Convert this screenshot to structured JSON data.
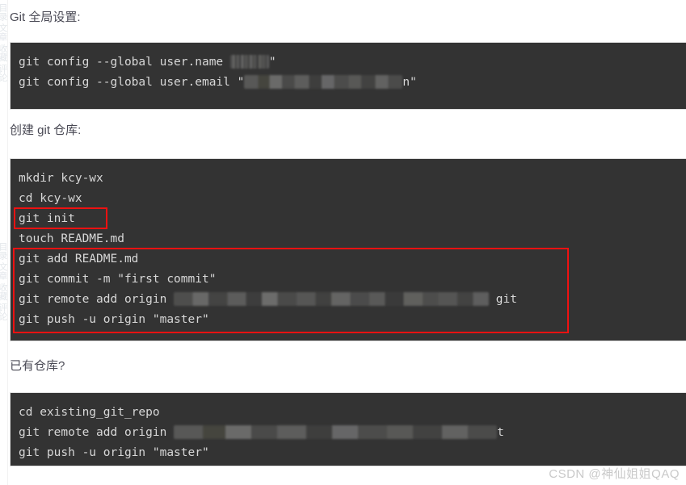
{
  "page": {
    "background": "#ffffff",
    "code_background": "#333333",
    "code_text_color": "#d7d7d7",
    "title_color": "#4a4a55",
    "annotation_color": "#ee1111"
  },
  "sections": [
    {
      "id": "global-settings",
      "title": "Git 全局设置:",
      "lines": [
        {
          "prefix": "git config --global user.name ",
          "redacted": true,
          "suffix": "\""
        },
        {
          "prefix": "git config --global user.email \"",
          "redacted": true,
          "suffix": "n\""
        }
      ]
    },
    {
      "id": "create-repo",
      "title": "创建 git 仓库:",
      "lines": [
        {
          "prefix": "mkdir kcy-wx",
          "redacted": false,
          "suffix": ""
        },
        {
          "prefix": "cd kcy-wx",
          "redacted": false,
          "suffix": ""
        },
        {
          "prefix": "git init",
          "redacted": false,
          "suffix": ""
        },
        {
          "prefix": "touch README.md",
          "redacted": false,
          "suffix": ""
        },
        {
          "prefix": "git add README.md",
          "redacted": false,
          "suffix": ""
        },
        {
          "prefix": "git commit -m \"first commit\"",
          "redacted": false,
          "suffix": ""
        },
        {
          "prefix": "git remote add origin ",
          "redacted": true,
          "suffix": " git"
        },
        {
          "prefix": "git push -u origin \"master\"",
          "redacted": false,
          "suffix": ""
        }
      ]
    },
    {
      "id": "existing-repo",
      "title": "已有仓库?",
      "lines": [
        {
          "prefix": "cd existing_git_repo",
          "redacted": false,
          "suffix": ""
        },
        {
          "prefix": "git remote add origin ",
          "redacted": true,
          "suffix": "t"
        },
        {
          "prefix": "git push -u origin \"master\"",
          "redacted": false,
          "suffix": ""
        }
      ]
    }
  ],
  "annotations": [
    {
      "id": "highlight-git-init",
      "label": "git init"
    },
    {
      "id": "highlight-push-sequence",
      "label": "git add / commit / remote add / push"
    }
  ],
  "watermark": {
    "prefix": "CSDN ",
    "handle": "@神仙姐姐QAQ"
  },
  "edge_strip": {
    "ghost_text": "目录 文章 收藏 评论"
  }
}
